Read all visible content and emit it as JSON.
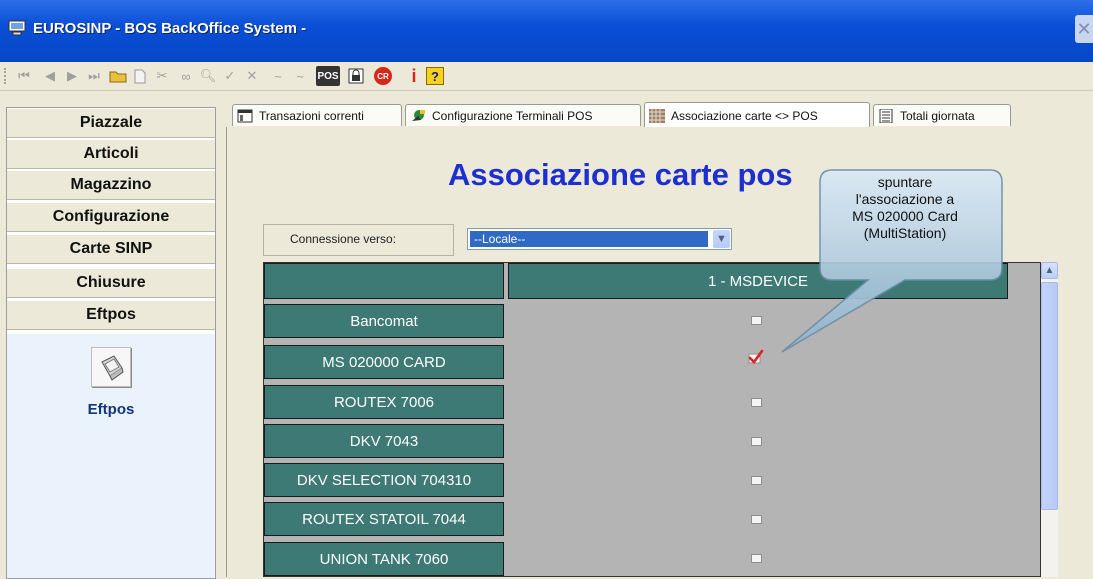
{
  "window": {
    "title": "EUROSINP - BOS BackOffice System -"
  },
  "toolbar": {
    "icons": [
      "first-record-icon",
      "prev-record-icon",
      "next-record-icon",
      "last-record-icon",
      "open-folder-icon",
      "new-document-icon",
      "cut-icon",
      "binoculars-icon",
      "search-icon",
      "confirm-icon",
      "cancel-icon",
      "signature-icon",
      "signature-alt-icon",
      "pos-icon",
      "lock-icon",
      "cr-icon",
      "info-icon",
      "help-icon"
    ],
    "pos_label": "POS",
    "cr_label": "CR",
    "info_label": "i",
    "help_label": "?"
  },
  "sidebar": {
    "items": [
      {
        "label": "Piazzale"
      },
      {
        "label": "Articoli"
      },
      {
        "label": "Magazzino"
      },
      {
        "label": "Configurazione"
      },
      {
        "label": "Carte SINP"
      },
      {
        "label": "Chiusure"
      },
      {
        "label": "Eftpos"
      }
    ],
    "panel": {
      "icon": "card-reader-icon",
      "label": "Eftpos"
    }
  },
  "tabs": [
    {
      "label": "Transazioni correnti",
      "icon": "list-icon",
      "active": false
    },
    {
      "label": "Configurazione Terminali POS",
      "icon": "terminal-icon",
      "active": false
    },
    {
      "label": "Associazione carte <> POS",
      "icon": "pattern-icon",
      "active": true
    },
    {
      "label": "Totali giornata",
      "icon": "document-icon",
      "active": false
    }
  ],
  "main": {
    "heading": "Associazione carte pos",
    "connection": {
      "label": "Connessione verso:",
      "value": "--Locale--"
    },
    "grid": {
      "column_header": "1 - MSDEVICE",
      "rows": [
        {
          "card": "Bancomat",
          "checked": false
        },
        {
          "card": "MS 020000 CARD",
          "checked": true
        },
        {
          "card": "ROUTEX 7006",
          "checked": false
        },
        {
          "card": "DKV 7043",
          "checked": false
        },
        {
          "card": "DKV SELECTION 704310",
          "checked": false
        },
        {
          "card": "ROUTEX STATOIL 7044",
          "checked": false
        },
        {
          "card": "UNION TANK 7060",
          "checked": false
        }
      ]
    }
  },
  "callout": {
    "lines": [
      "spuntare",
      "l'associazione a",
      "MS 020000 Card",
      "(MultiStation)"
    ]
  },
  "colors": {
    "titlebar": "#0a4fd6",
    "grid_cell": "#3e7a75",
    "heading": "#1d2fd0",
    "check": "#e02020"
  }
}
